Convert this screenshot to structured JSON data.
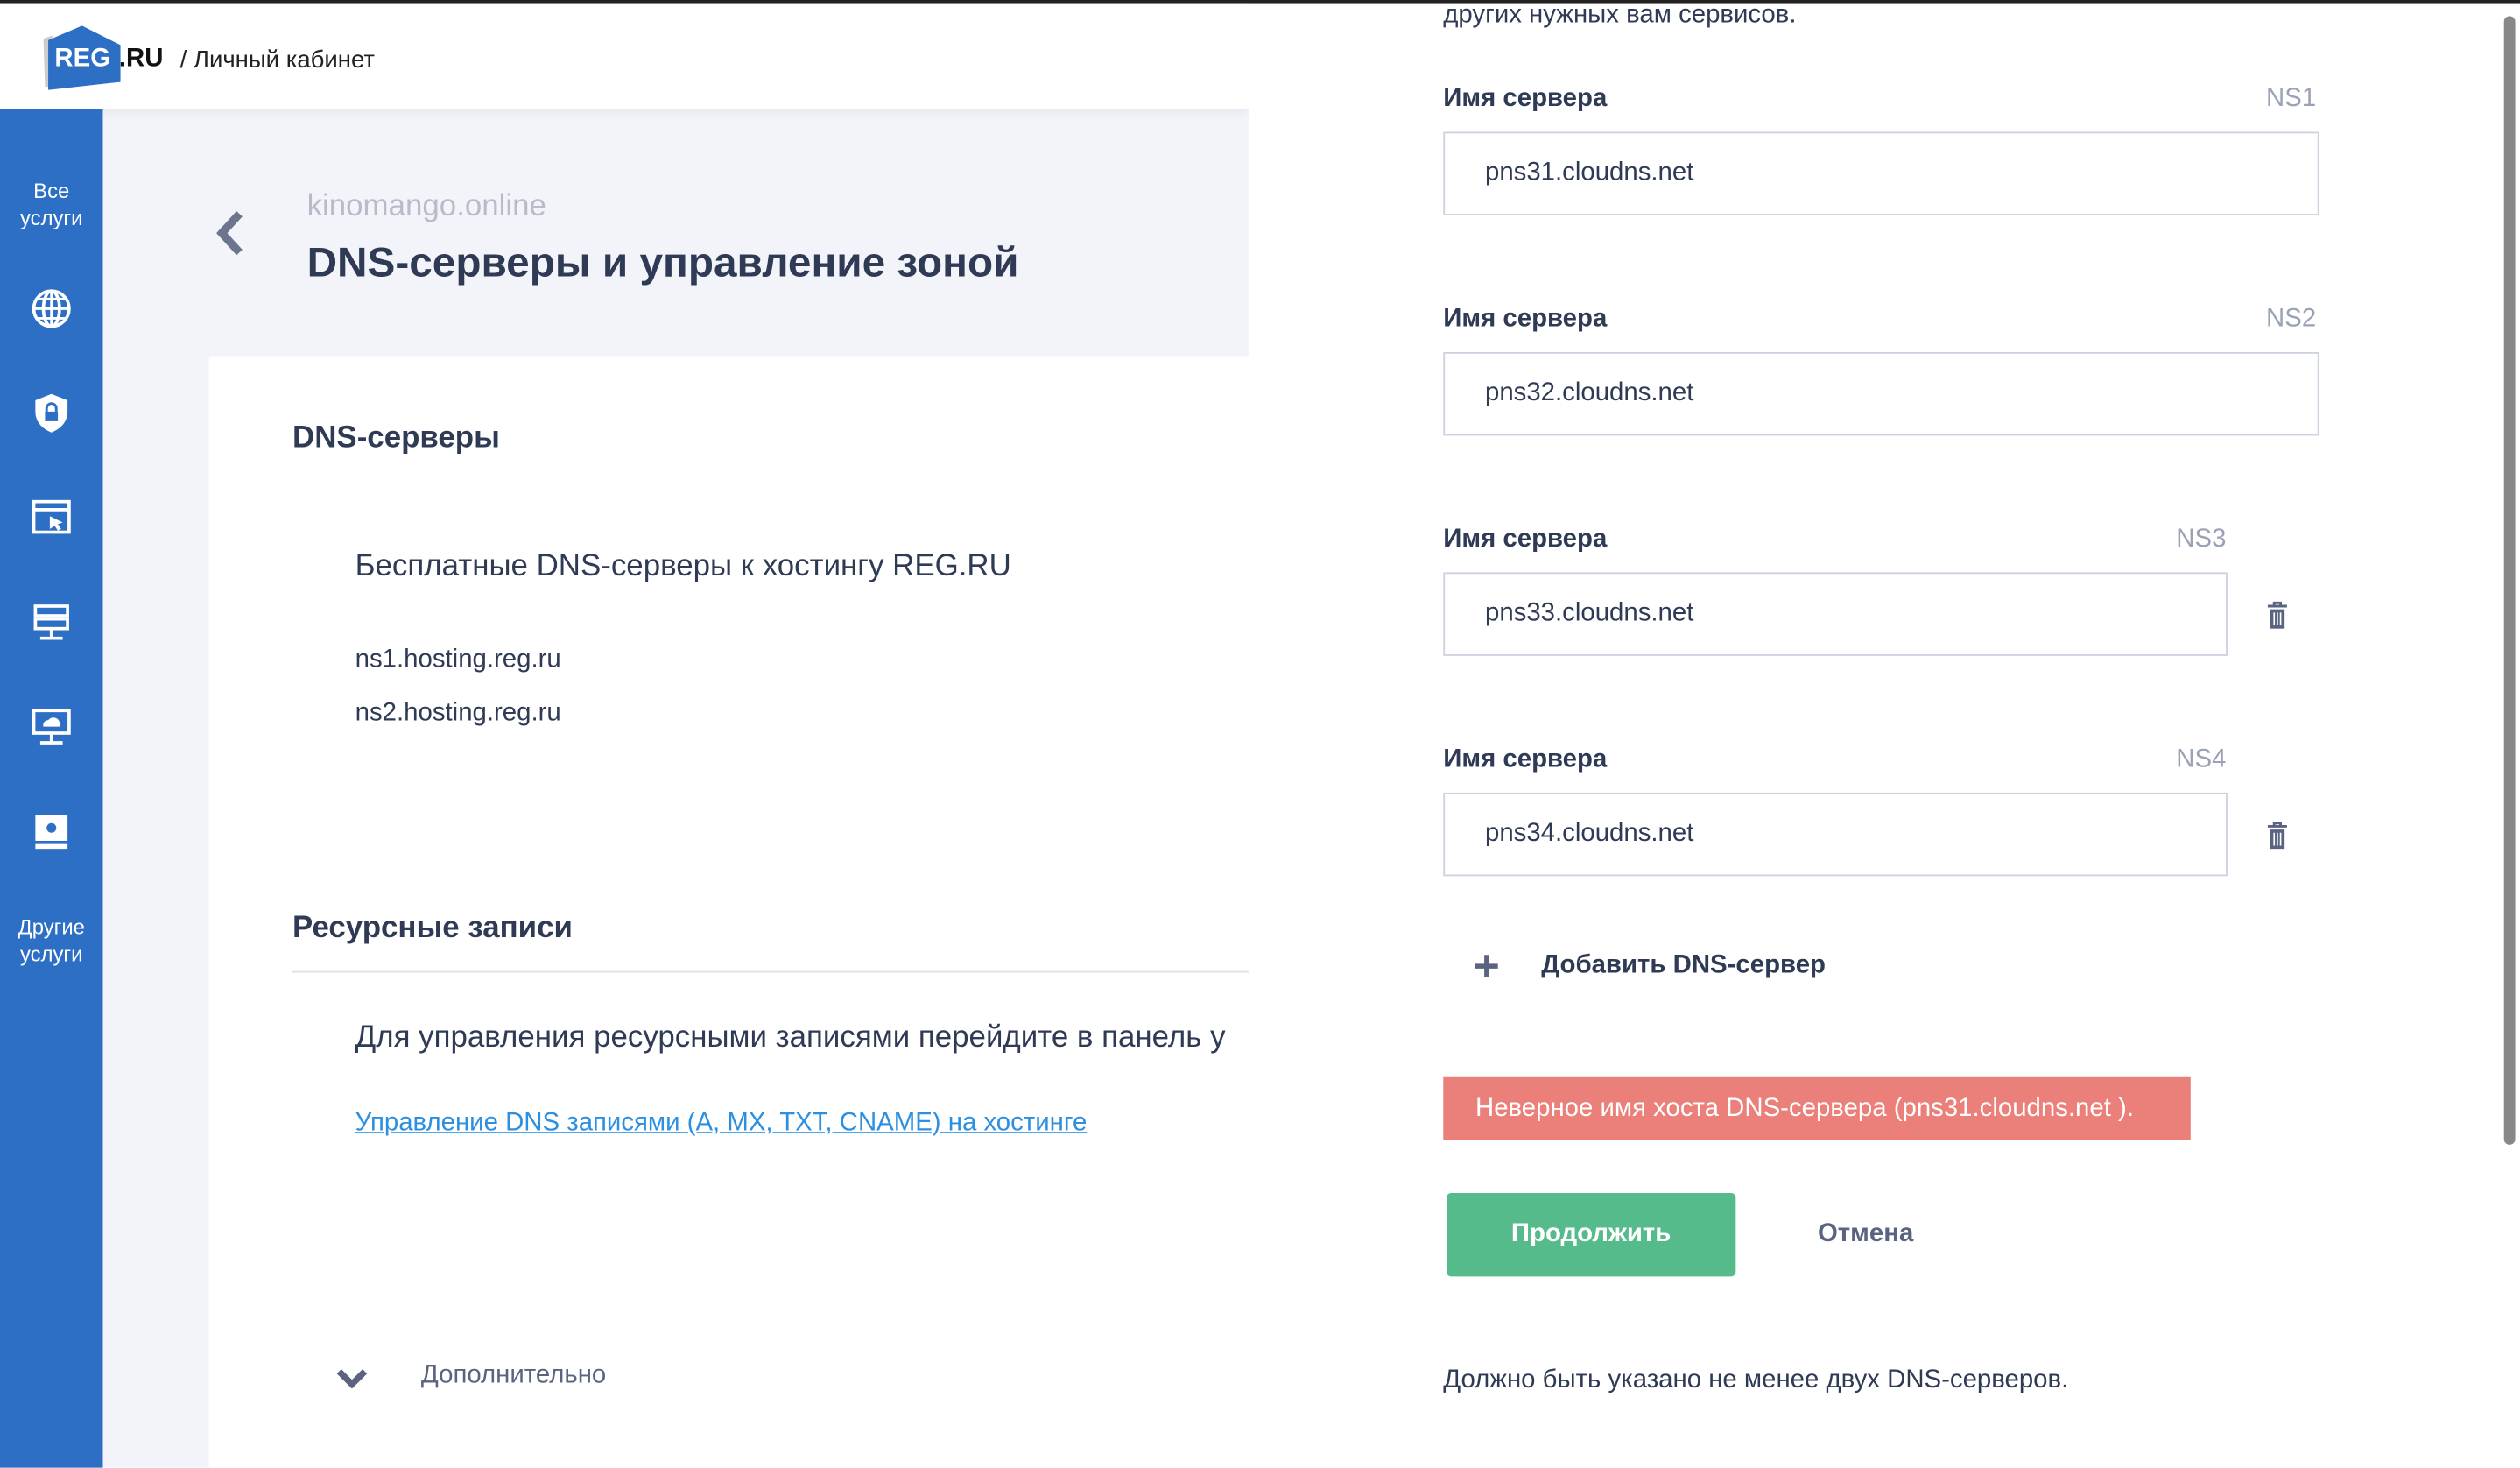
{
  "header": {
    "logo_text": "REG",
    "logo_suffix": ".RU",
    "breadcrumb": "/ Личный кабинет"
  },
  "sidebar": {
    "all_services": "Все услуги",
    "other_services": "Другие услуги",
    "icons": [
      "globe-icon",
      "shield-lock-icon",
      "website-builder-icon",
      "server-icon",
      "cloud-server-icon",
      "hosting-icon"
    ]
  },
  "page": {
    "domain": "kinomango.online",
    "title": "DNS-серверы и управление зоной"
  },
  "dns_section": {
    "heading": "DNS-серверы",
    "free_title": "Бесплатные DNS-серверы к хостингу REG.RU",
    "servers": [
      "ns1.hosting.reg.ru",
      "ns2.hosting.reg.ru"
    ]
  },
  "records_section": {
    "heading": "Ресурсные записи",
    "text": "Для управления ресурсными записями перейдите в панель у",
    "link": "Управление DNS записями (A, MX, TXT, CNAME) на хостинге"
  },
  "more": {
    "label": "Дополнительно"
  },
  "panel": {
    "intro_tail": "других нужных вам сервисов.",
    "fields": [
      {
        "label": "Имя сервера",
        "tag": "NS1",
        "value": "pns31.cloudns.net"
      },
      {
        "label": "Имя сервера",
        "tag": "NS2",
        "value": "pns32.cloudns.net"
      },
      {
        "label": "Имя сервера",
        "tag": "NS3",
        "value": "pns33.cloudns.net"
      },
      {
        "label": "Имя сервера",
        "tag": "NS4",
        "value": "pns34.cloudns.net"
      }
    ],
    "add_label": "Добавить DNS-сервер",
    "error": "Неверное имя хоста DNS-сервера (pns31.cloudns.net ).",
    "continue_label": "Продолжить",
    "cancel_label": "Отмена",
    "note": "Должно быть указано не менее двух DNS-серверов."
  },
  "colors": {
    "brand": "#2d6fc4",
    "error": "#eb7f7a",
    "success": "#55bb8a",
    "link": "#2d8fe0"
  }
}
